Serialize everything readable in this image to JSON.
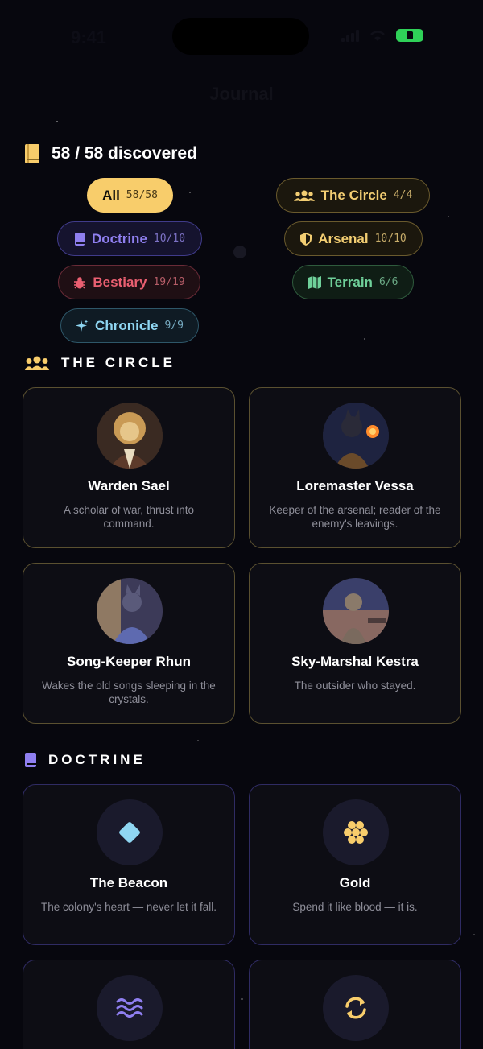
{
  "status_bar": {
    "time": "9:41"
  },
  "nav": {
    "title": "Journal"
  },
  "summary": {
    "discovered": "58 / 58 discovered"
  },
  "filters": [
    {
      "label": "All",
      "count": "58/58"
    },
    {
      "label": "The Circle",
      "count": "4/4"
    },
    {
      "label": "Doctrine",
      "count": "10/10"
    },
    {
      "label": "Arsenal",
      "count": "10/10"
    },
    {
      "label": "Bestiary",
      "count": "19/19"
    },
    {
      "label": "Terrain",
      "count": "6/6"
    },
    {
      "label": "Chronicle",
      "count": "9/9"
    }
  ],
  "colors": {
    "gold": "#f8cd6b",
    "doctrine": "#8f7ff0",
    "bestiary": "#ea5f71",
    "terrain": "#6fd09a",
    "chronicle": "#8fd6f2"
  },
  "sections": {
    "circle": {
      "title": "THE CIRCLE",
      "icon": "people-icon",
      "cards": [
        {
          "name": "Warden Sael",
          "desc": "A scholar of war, thrust into command."
        },
        {
          "name": "Loremaster Vessa",
          "desc": "Keeper of the arsenal; reader of the enemy's leavings."
        },
        {
          "name": "Song-Keeper Rhun",
          "desc": "Wakes the old songs sleeping in the crystals."
        },
        {
          "name": "Sky-Marshal Kestra",
          "desc": "The outsider who stayed."
        }
      ]
    },
    "doctrine": {
      "title": "DOCTRINE",
      "icon": "book-icon",
      "cards": [
        {
          "name": "The Beacon",
          "desc": "The colony's heart — never let it fall.",
          "icon": "diamond-icon"
        },
        {
          "name": "Gold",
          "desc": "Spend it like blood — it is.",
          "icon": "gold-coins-icon"
        },
        {
          "name": "",
          "desc": "",
          "icon": "waves-icon"
        },
        {
          "name": "",
          "desc": "",
          "icon": "cycle-icon"
        }
      ]
    }
  }
}
